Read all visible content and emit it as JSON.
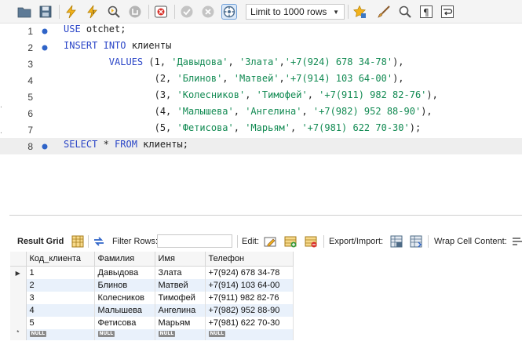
{
  "toolbar": {
    "limit_select": "Limit to 1000 rows",
    "icons": [
      "open-folder-icon",
      "save-icon",
      "execute-icon",
      "execute-current-icon",
      "explain-icon",
      "stop-icon",
      "toggle-error-icon",
      "commit-icon",
      "rollback-icon",
      "autocommit-icon",
      "beautify-star-icon",
      "brush-icon",
      "find-icon",
      "invisible-chars-icon",
      "wrap-icon"
    ]
  },
  "editor": {
    "line_numbers": [
      "1",
      "2",
      "3",
      "4",
      "5",
      "6",
      "7",
      "8"
    ]
  },
  "result": {
    "tab_label": "Result Grid",
    "filter_label": "Filter Rows:",
    "filter_value": "",
    "edit_label": "Edit:",
    "export_label": "Export/Import:",
    "wrap_label": "Wrap Cell Content:",
    "columns": [
      "Код_клиента",
      "Фамилия",
      "Имя",
      "Телефон"
    ],
    "rows": [
      [
        "1",
        "Давыдова",
        "Злата",
        "+7(924) 678 34-78"
      ],
      [
        "2",
        "Блинов",
        "Матвей",
        "+7(914) 103 64-00"
      ],
      [
        "3",
        "Колесников",
        "Тимофей",
        "+7(911) 982 82-76"
      ],
      [
        "4",
        "Малышева",
        "Ангелина",
        "+7(982) 952 88-90"
      ],
      [
        "5",
        "Фетисова",
        "Марьям",
        "+7(981) 622 70-30"
      ]
    ],
    "null_label": "NULL",
    "current_row_marker": "▶",
    "new_row_marker": "*"
  }
}
